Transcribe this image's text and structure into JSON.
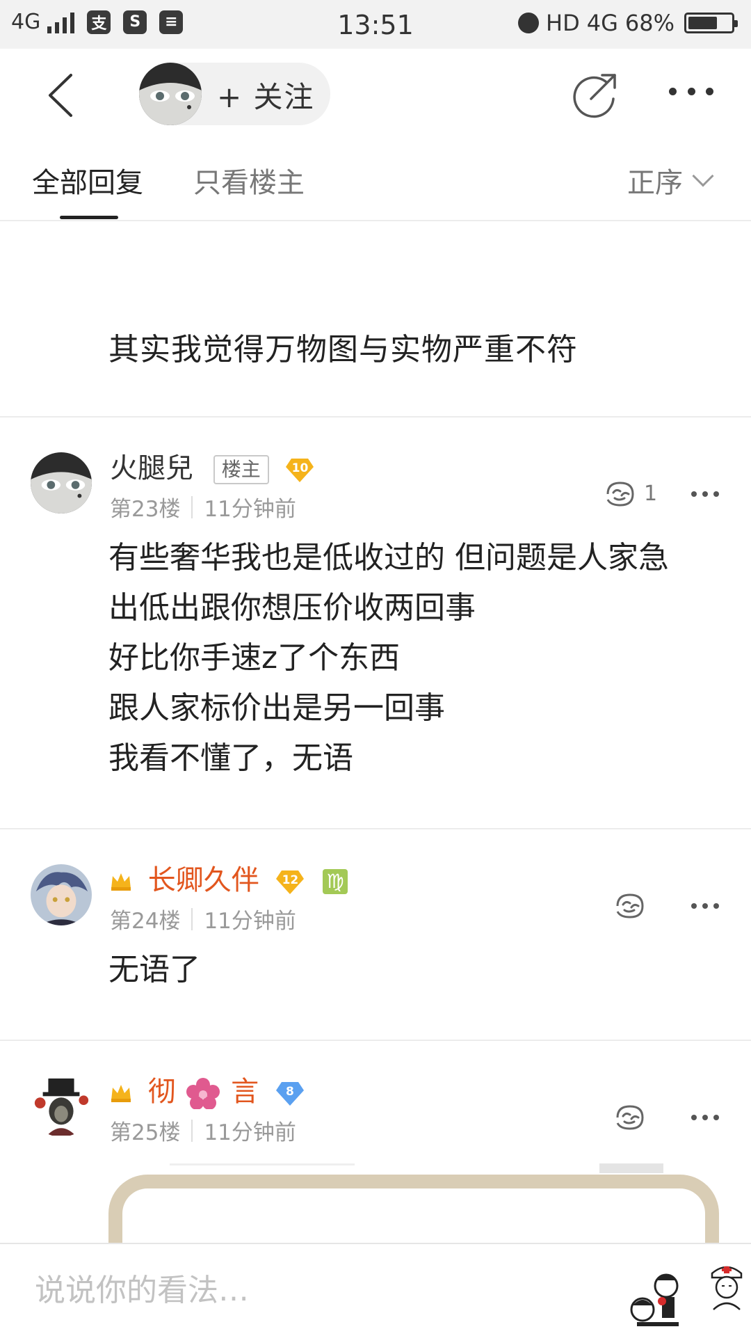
{
  "status_bar": {
    "network": "4G",
    "time": "13:51",
    "hd": "HD",
    "network_right": "4G",
    "battery": "68%",
    "battery_fill_fraction": 0.68,
    "app_icons": [
      "alipay-icon",
      "sina-icon",
      "stack-icon"
    ]
  },
  "nav": {
    "follow_label": "+ 关注"
  },
  "tabs": {
    "all": "全部回复",
    "owner_only": "只看楼主",
    "sort": "正序"
  },
  "top_reply": {
    "text": "其实我觉得万物图与实物严重不符"
  },
  "posts": [
    {
      "username": "火腿兒",
      "owner_tag": "楼主",
      "level": "10",
      "floor": "第23楼",
      "time": "11分钟前",
      "likes": "1",
      "lines": [
        "有些奢华我也是低收过的 但问题是人家急",
        "出低出跟你想压价收两回事",
        "好比你手速z了个东西",
        "跟人家标价出是另一回事",
        "我看不懂了，无语"
      ]
    },
    {
      "username": "长卿久伴",
      "level": "12",
      "zodiac": "♍",
      "floor": "第24楼",
      "time": "11分钟前",
      "lines": [
        "无语了"
      ]
    },
    {
      "username_a": "彻",
      "username_b": "言",
      "level": "8",
      "floor": "第25楼",
      "time": "11分钟前"
    }
  ],
  "bottom": {
    "placeholder": "说说你的看法…"
  },
  "colors": {
    "vip_name": "#e2561e",
    "level_gold": "#f5b31b",
    "level_blue": "#5aa0f0",
    "virgo_green": "#a3c956"
  }
}
